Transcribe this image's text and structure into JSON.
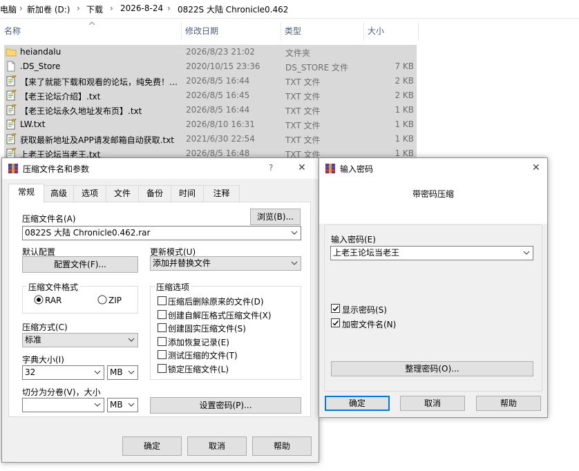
{
  "address": {
    "crumbs": [
      "电脑",
      "新加卷 (D:)",
      "下载",
      "2026-8-24",
      "0822S 大陆 Chronicle0.462"
    ],
    "separator": "›"
  },
  "columns": {
    "name": "名称",
    "date": "修改日期",
    "type": "类型",
    "size": "大小"
  },
  "files": [
    {
      "name": "heiandalu",
      "date": "2026/8/23 21:02",
      "type": "文件夹",
      "size": "",
      "icon": "folder-icon"
    },
    {
      "name": ".DS_Store",
      "date": "2020/10/15 23:36",
      "type": "DS_STORE 文件",
      "size": "7 KB",
      "icon": "file-icon"
    },
    {
      "name": "【来了就能下载和观看的论坛，纯免费！…",
      "date": "2026/8/5 16:44",
      "type": "TXT 文件",
      "size": "2 KB",
      "icon": "text-file-icon"
    },
    {
      "name": "【老王论坛介绍】.txt",
      "date": "2026/8/5 16:45",
      "type": "TXT 文件",
      "size": "2 KB",
      "icon": "text-file-icon"
    },
    {
      "name": "【老王论坛永久地址发布页】.txt",
      "date": "2026/8/5 16:44",
      "type": "TXT 文件",
      "size": "1 KB",
      "icon": "text-file-icon"
    },
    {
      "name": "LW.txt",
      "date": "2026/8/10 16:31",
      "type": "TXT 文件",
      "size": "1 KB",
      "icon": "text-file-icon"
    },
    {
      "name": "获取最新地址及APP请发邮箱自动获取.txt",
      "date": "2021/6/30 22:54",
      "type": "TXT 文件",
      "size": "1 KB",
      "icon": "text-file-icon"
    },
    {
      "name": "上老王论坛当老王.txt",
      "date": "2026/8/5 16:48",
      "type": "TXT 文件",
      "size": "1 KB",
      "icon": "text-file-icon"
    }
  ],
  "archive_dialog": {
    "title": "压缩文件名和参数",
    "help_glyph": "?",
    "close_glyph": "✕",
    "tabs": [
      "常规",
      "高级",
      "选项",
      "文件",
      "备份",
      "时间",
      "注释"
    ],
    "archive_name_label": "压缩文件名(A)",
    "browse_label": "浏览(B)...",
    "archive_name_value": "0822S 大陆 Chronicle0.462.rar",
    "default_profile_label": "默认配置",
    "profiles_button": "配置文件(F)...",
    "update_mode_label": "更新模式(U)",
    "update_mode_value": "添加并替换文件",
    "format_group": "压缩文件格式",
    "format_rar": "RAR",
    "format_zip": "ZIP",
    "options_group": "压缩选项",
    "options": [
      "压缩后删除原来的文件(D)",
      "创建自解压格式压缩文件(X)",
      "创建固实压缩文件(S)",
      "添加恢复记录(E)",
      "测试压缩的文件(T)",
      "锁定压缩文件(L)"
    ],
    "method_label": "压缩方式(C)",
    "method_value": "标准",
    "dict_label": "字典大小(I)",
    "dict_value": "32",
    "dict_unit": "MB",
    "split_label": "切分为分卷(V)，大小",
    "split_value": "",
    "split_unit": "MB",
    "set_password_button": "设置密码(P)...",
    "ok": "确定",
    "cancel": "取消",
    "help": "帮助"
  },
  "password_dialog": {
    "title": "输入密码",
    "close_glyph": "✕",
    "heading": "带密码压缩",
    "password_label": "输入密码(E)",
    "password_value": "上老王论坛当老王",
    "show_password": "显示密码(S)",
    "encrypt_names": "加密文件名(N)",
    "organize_button": "整理密码(O)...",
    "ok": "确定",
    "cancel": "取消",
    "help": "帮助"
  },
  "colors": {
    "selection": "#d9d9d9",
    "accent": "#0078d7",
    "dialog_bg": "#f0f0f0",
    "folder": "#f8d775"
  }
}
